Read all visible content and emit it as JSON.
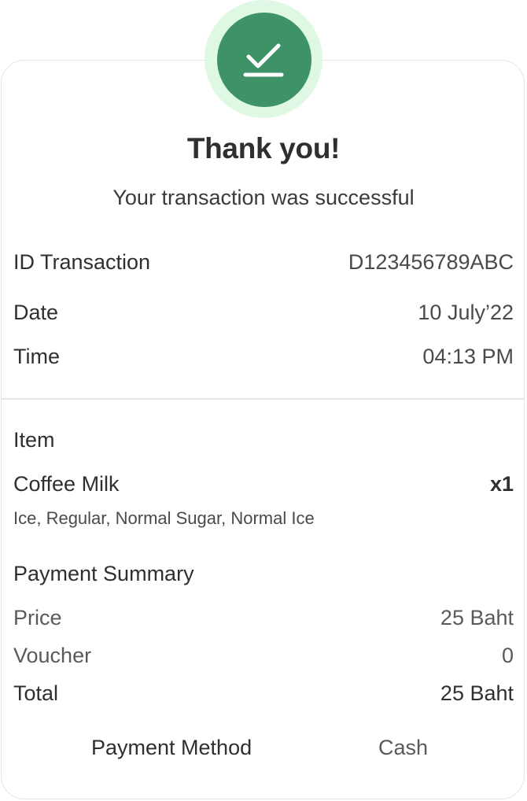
{
  "header": {
    "title": "Thank you!",
    "subtitle": "Your transaction was successful",
    "status_icon": "check-icon",
    "accent_color": "#3e9268",
    "badge_ring_color": "#dff8e4"
  },
  "transaction": {
    "id_label": "ID Transaction",
    "id_value": "D123456789ABC",
    "date_label": "Date",
    "date_value": "10 July’22",
    "time_label": "Time",
    "time_value": "04:13 PM"
  },
  "item": {
    "section_label": "Item",
    "name": "Coffee Milk",
    "quantity": "x1",
    "options": "Ice, Regular, Normal Sugar, Normal Ice"
  },
  "payment_summary": {
    "section_label": "Payment Summary",
    "price_label": "Price",
    "price_value": "25 Baht",
    "voucher_label": "Voucher",
    "voucher_value": "0",
    "total_label": "Total",
    "total_value": "25 Baht"
  },
  "payment_method": {
    "label": "Payment Method",
    "value": "Cash"
  }
}
